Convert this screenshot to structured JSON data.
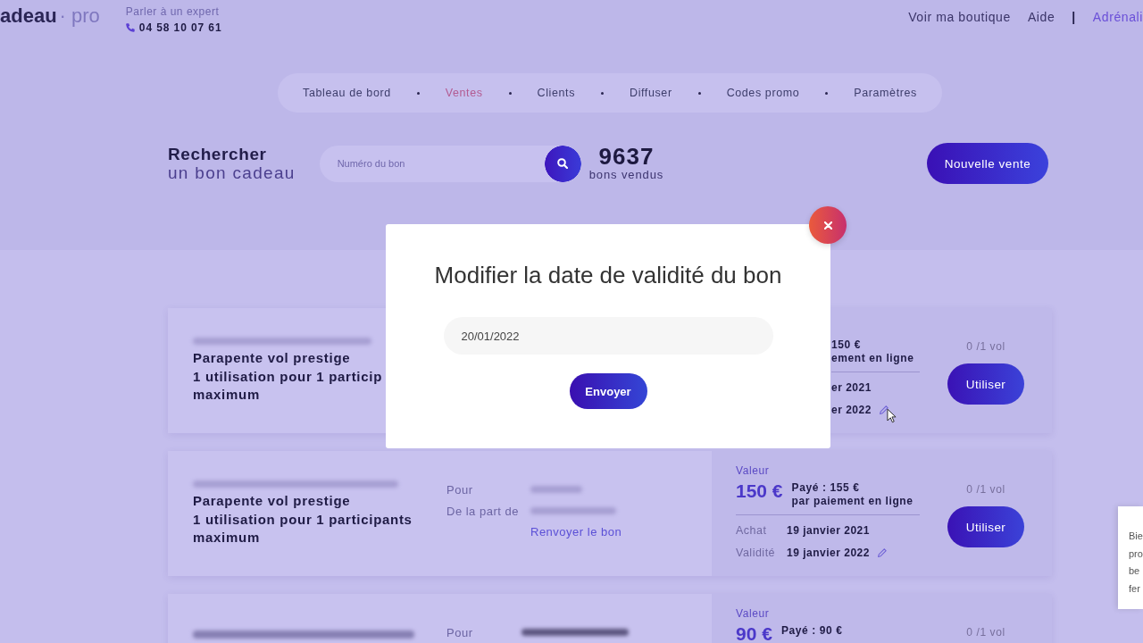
{
  "header": {
    "logo": {
      "name": "adeau",
      "suffix": "· pro"
    },
    "contact": {
      "label": "Parler à un expert",
      "phone": "04 58 10 07 61"
    },
    "links": [
      {
        "label": "Voir ma boutique",
        "kind": "link"
      },
      {
        "label": "Aide",
        "kind": "link"
      },
      {
        "label": "|",
        "kind": "separator"
      },
      {
        "label": "Adrénali",
        "kind": "account"
      }
    ]
  },
  "nav": {
    "items": [
      {
        "label": "Tableau de bord",
        "selected": false
      },
      {
        "label": "Ventes",
        "selected": true
      },
      {
        "label": "Clients",
        "selected": false
      },
      {
        "label": "Diffuser",
        "selected": false
      },
      {
        "label": "Codes promo",
        "selected": false
      },
      {
        "label": "Paramètres",
        "selected": false
      }
    ]
  },
  "search": {
    "title": "Rechercher",
    "subtitle": "un bon cadeau",
    "placeholder": "Numéro du bon",
    "count": "9637",
    "count_label": "bons vendus",
    "new_button": "Nouvelle vente"
  },
  "vouchers": [
    {
      "title_lines": [
        "Parapente vol prestige",
        "1 utilisation pour 1 particip",
        "maximum"
      ],
      "paid": "150 €",
      "payment": "ement en ligne",
      "purchase_date": "er 2021",
      "validity_date": "er 2022",
      "usage": "0 /1 vol",
      "use_button": "Utiliser"
    },
    {
      "title_lines": [
        "Parapente vol prestige",
        "1 utilisation pour 1 participants",
        "maximum"
      ],
      "details": [
        {
          "label": "Pour"
        },
        {
          "label": "De la part de"
        }
      ],
      "resend_link": "Renvoyer le bon",
      "value_label": "Valeur",
      "value": "150 €",
      "paid": "Payé : 155 €",
      "payment": "par paiement en ligne",
      "purchase_label": "Achat",
      "purchase_date": "19 janvier 2021",
      "validity_label": "Validité",
      "validity_date": "19 janvier 2022",
      "usage": "0 /1 vol",
      "use_button": "Utiliser"
    },
    {
      "details": [
        {
          "label": "Pour"
        }
      ],
      "value_label": "Valeur",
      "value": "90 €",
      "paid": "Payé : 90 €",
      "usage": "0 /1 vol"
    }
  ],
  "modal": {
    "title": "Modifier la date de validité du bon",
    "date_value": "20/01/2022",
    "submit": "Envoyer"
  },
  "side_popup": {
    "lines": [
      "Bie",
      "pro",
      "be",
      "fer"
    ]
  }
}
